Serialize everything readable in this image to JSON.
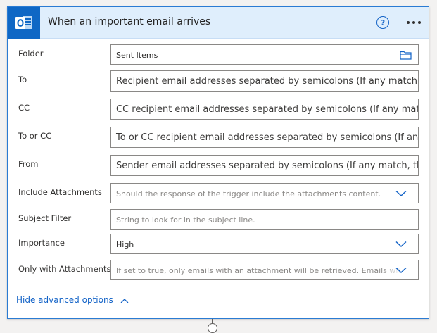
{
  "trigger": {
    "title": "When an important email arrives",
    "app_icon": "outlook-icon",
    "help_label": "?",
    "more_icon": "more-options-icon"
  },
  "fields": {
    "folder": {
      "label": "Folder",
      "value": "Sent Items",
      "icon": "folder-picker-icon"
    },
    "to": {
      "label": "To",
      "placeholder": "Recipient email addresses separated by semicolons (If any match, the trigger will run)"
    },
    "cc": {
      "label": "CC",
      "placeholder": "CC recipient email addresses separated by semicolons (If any match, the trigger will run)"
    },
    "to_or_cc": {
      "label": "To or CC",
      "placeholder": "To or CC recipient email addresses separated by semicolons (If any match, the trigger will run)"
    },
    "from": {
      "label": "From",
      "placeholder": "Sender email addresses separated by semicolons (If any match, the trigger will run)"
    },
    "include_attachments": {
      "label": "Include Attachments",
      "placeholder": "Should the response of the trigger include the attachments content."
    },
    "subject_filter": {
      "label": "Subject Filter",
      "placeholder": "String to look for in the subject line."
    },
    "importance": {
      "label": "Importance",
      "value": "High"
    },
    "only_with_attachments": {
      "label": "Only with Attachments",
      "placeholder": "If set to true, only emails with an attachment will be retrieved. Emails without any attachments will be skipped."
    }
  },
  "advanced": {
    "toggle_label": "Hide advanced options"
  },
  "colors": {
    "accent": "#1363c7",
    "header_bg": "#dfeefc",
    "tile_bg": "#0f67c5",
    "border": "#2a7bd3"
  }
}
